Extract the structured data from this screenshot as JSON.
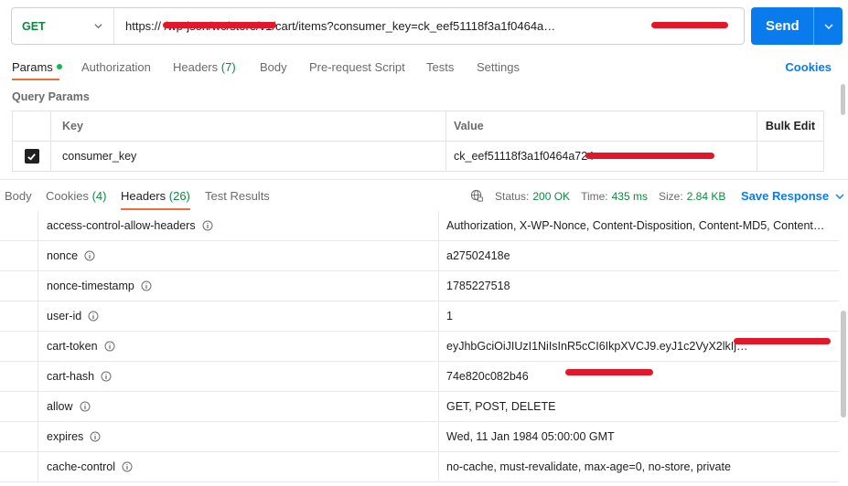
{
  "request": {
    "method": "GET",
    "url": "https://                    /wp-json/wc/store/v1/cart/items?consumer_key=ck_eef51118f3a1f0464a…",
    "send_label": "Send"
  },
  "tabs": {
    "params": "Params",
    "authorization": "Authorization",
    "headers": "Headers",
    "headers_count": "(7)",
    "body": "Body",
    "prerequest": "Pre-request Script",
    "tests": "Tests",
    "settings": "Settings",
    "cookies": "Cookies"
  },
  "query_params": {
    "title": "Query Params",
    "columns": {
      "key": "Key",
      "value": "Value",
      "bulk": "Bulk Edit"
    },
    "rows": [
      {
        "key": "consumer_key",
        "value": "ck_eef51118f3a1f0464a724",
        "checked": true
      }
    ]
  },
  "response": {
    "tabs": {
      "body": "Body",
      "cookies": "Cookies",
      "cookies_count": "(4)",
      "headers": "Headers",
      "headers_count": "(26)",
      "test_results": "Test Results"
    },
    "status_label": "Status:",
    "status_value": "200 OK",
    "time_label": "Time:",
    "time_value": "435 ms",
    "size_label": "Size:",
    "size_value": "2.84 KB",
    "save_label": "Save Response",
    "headers": [
      {
        "key": "access-control-allow-headers",
        "value": "Authorization, X-WP-Nonce, Content-Disposition, Content-MD5, Content…"
      },
      {
        "key": "nonce",
        "value": "a27502418e"
      },
      {
        "key": "nonce-timestamp",
        "value": "1785227518"
      },
      {
        "key": "user-id",
        "value": "1"
      },
      {
        "key": "cart-token",
        "value": "eyJhbGciOiJIUzI1NiIsInR5cCI6IkpXVCJ9.eyJ1c2VyX2lkIj…"
      },
      {
        "key": "cart-hash",
        "value": "74e820c082b46"
      },
      {
        "key": "allow",
        "value": "GET, POST, DELETE"
      },
      {
        "key": "expires",
        "value": "Wed, 11 Jan 1984 05:00:00 GMT"
      },
      {
        "key": "cache-control",
        "value": "no-cache, must-revalidate, max-age=0, no-store, private"
      }
    ]
  },
  "colors": {
    "accent": "#097bed",
    "method_get": "#0b8a3e",
    "active_tab": "#f26b3a",
    "status_ok": "#0b8a3e",
    "redaction": "#e3172a"
  }
}
